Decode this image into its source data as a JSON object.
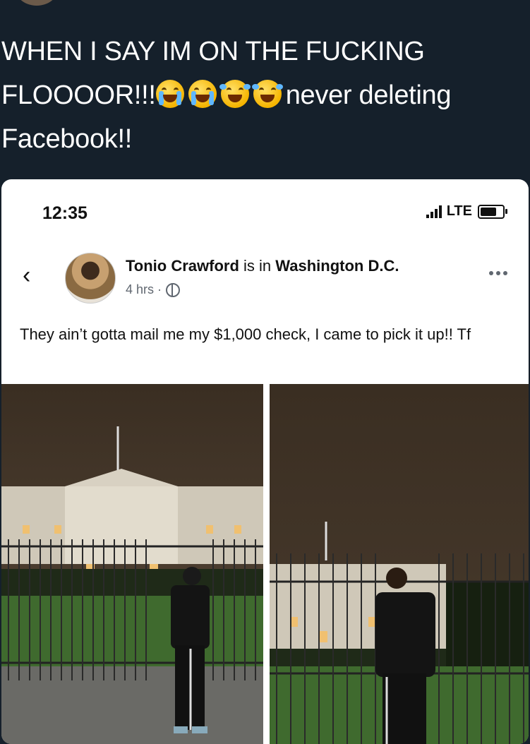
{
  "tweet": {
    "text_line1": "WHEN I SAY IM ON THE FUCKING",
    "text_line2_start": "FLOOOOR!!!",
    "text_line2_end": "never deleting",
    "text_line3": "Facebook!!",
    "emojis": [
      "loudly-crying-face",
      "loudly-crying-face",
      "face-with-tears-of-joy",
      "face-with-tears-of-joy"
    ]
  },
  "phone": {
    "time": "12:35",
    "network": "LTE"
  },
  "post": {
    "author": "Tonio Crawford",
    "is_in": "is in",
    "location": "Washington D.C.",
    "age": "4 hrs ·",
    "text": "They ain’t gotta mail me my $1,000 check, I came to pick it up!! Tf"
  },
  "colors": {
    "tweet_bg": "#15202b",
    "tweet_text": "#ffffff",
    "card_bg": "#ffffff",
    "meta_gray": "#606770"
  }
}
